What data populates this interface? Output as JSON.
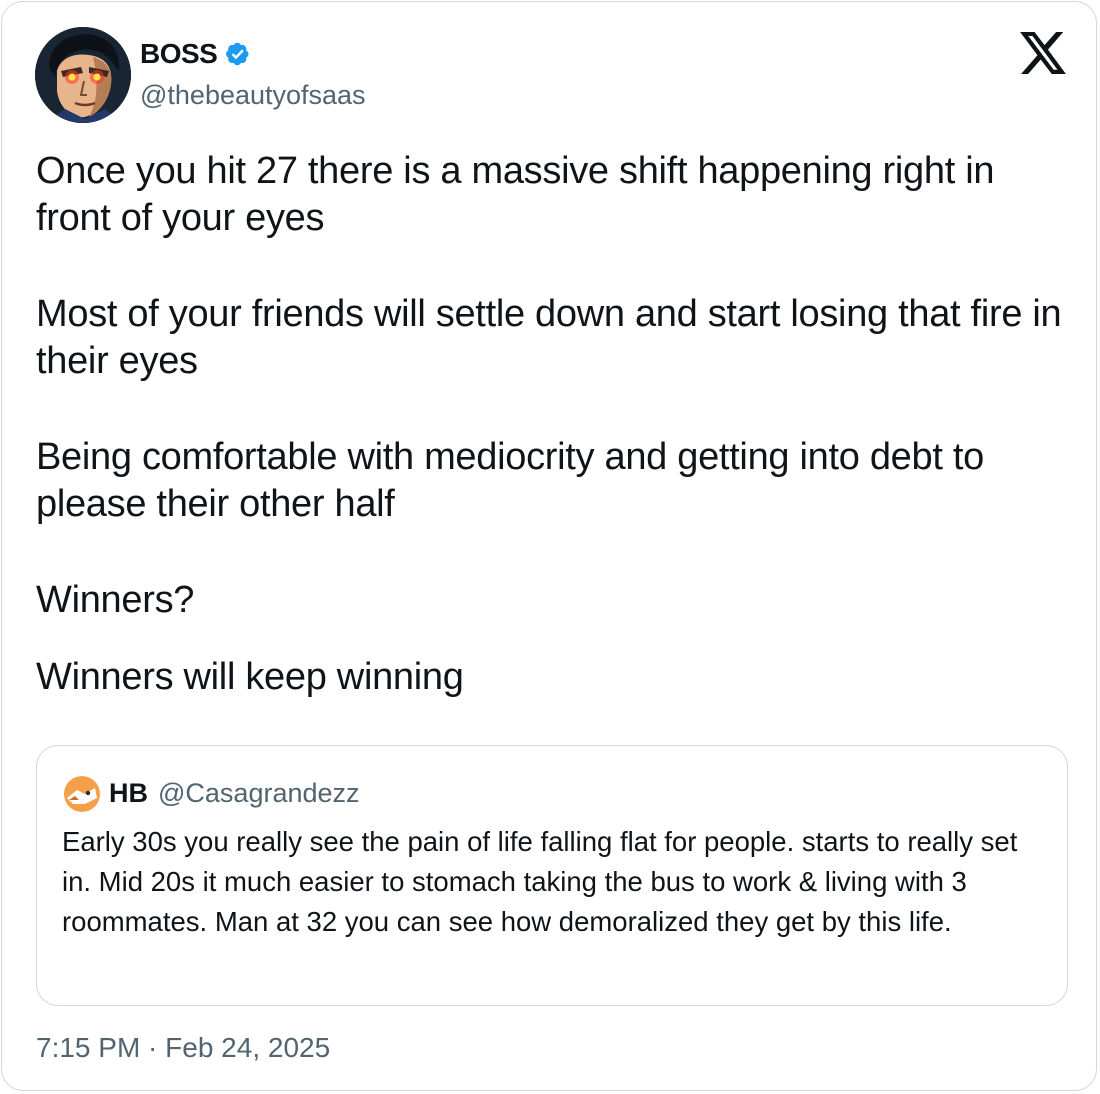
{
  "author": {
    "display_name": "BOSS",
    "handle": "@thebeautyofsaas",
    "avatar_icon": "avatar-comic-hero-glowing-eyes",
    "verified": true
  },
  "platform_logo": "x-logo-icon",
  "tweet": {
    "paragraphs": [
      "Once you hit 27 there is a massive shift happening right in front of your eyes",
      "Most of your friends will settle down and start losing that fire in their eyes",
      "Being comfortable with mediocrity and getting into debt to please their other half",
      "Winners?",
      "Winners will keep winning"
    ]
  },
  "quoted_tweet": {
    "display_name": "HB",
    "handle": "@Casagrandezz",
    "text": "Early 30s you really see the pain of life falling flat for people. starts to really set in. Mid 20s it much easier to stomach taking the bus to work & living with 3 roommates. Man at 32 you can see how demoralized they get by this life."
  },
  "timestamp": "7:15 PM · Feb 24, 2025",
  "colors": {
    "text_primary": "#0f1419",
    "text_secondary": "#536471",
    "border": "#cfd9de",
    "verified_blue": "#1d9bf0"
  }
}
